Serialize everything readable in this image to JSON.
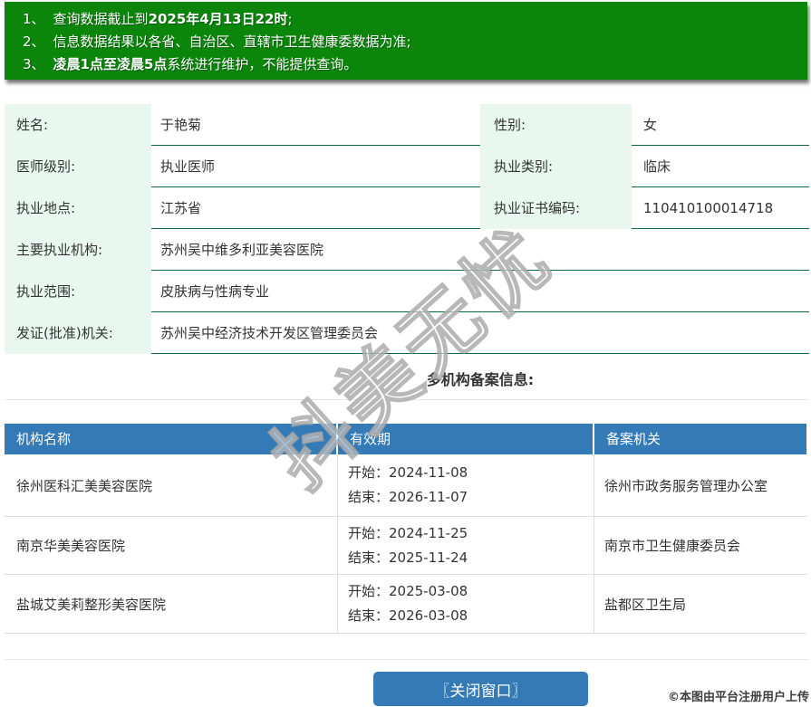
{
  "colors": {
    "banner_green": "#0b860b",
    "label_bg_green": "#e9f8ef",
    "row_border_green": "#0a6b3c",
    "table_header_blue": "#337ab7",
    "button_blue": "#337ab7",
    "light_border_gray": "#dddddd",
    "text": "#333333"
  },
  "notice": {
    "items": [
      {
        "num": "1、",
        "pre": "查询数据截止到",
        "bold": "2025年4月13日22时",
        "post": ";"
      },
      {
        "num": "2、",
        "pre": "信息数据结果以各省、自治区、直辖市卫生健康委数据为准;",
        "bold": "",
        "post": ""
      },
      {
        "num": "3、",
        "pre": "",
        "bold": "凌晨1点至凌晨5点",
        "post": "系统进行维护，不能提供查询。"
      }
    ]
  },
  "doctor": {
    "rows": [
      {
        "label": "姓名:",
        "value": "于艳菊",
        "label2": "性别:",
        "value2": "女"
      },
      {
        "label": "医师级别:",
        "value": "执业医师",
        "label2": "执业类别:",
        "value2": "临床"
      },
      {
        "label": "执业地点:",
        "value": "江苏省",
        "label2": "执业证书编码:",
        "value2": "110410100014718"
      },
      {
        "label": "主要执业机构:",
        "value": "苏州吴中维多利亚美容医院"
      },
      {
        "label": "执业范围:",
        "value": "皮肤病与性病专业"
      },
      {
        "label": "发证(批准)机关:",
        "value": "苏州吴中经济技术开发区管理委员会"
      }
    ]
  },
  "multi_org": {
    "heading": "多机构备案信息:",
    "columns": [
      "机构名称",
      "有效期",
      "备案机关"
    ],
    "rows": [
      {
        "name": "徐州医科汇美美容医院",
        "start": "开始：2024-11-08",
        "end": "结束：2026-11-07",
        "authority": "徐州市政务服务管理办公室"
      },
      {
        "name": "南京华美美容医院",
        "start": "开始：2024-11-25",
        "end": "结束：2025-11-24",
        "authority": "南京市卫生健康委员会"
      },
      {
        "name": "盐城艾美莉整形美容医院",
        "start": "开始：2025-03-08",
        "end": "结束：2026-03-08",
        "authority": "盐都区卫生局"
      }
    ]
  },
  "close_button": {
    "label": "〖关闭窗口〗"
  },
  "watermark": {
    "text": "抖美无忧"
  },
  "credit": {
    "text": "©本图由平台注册用户上传"
  }
}
